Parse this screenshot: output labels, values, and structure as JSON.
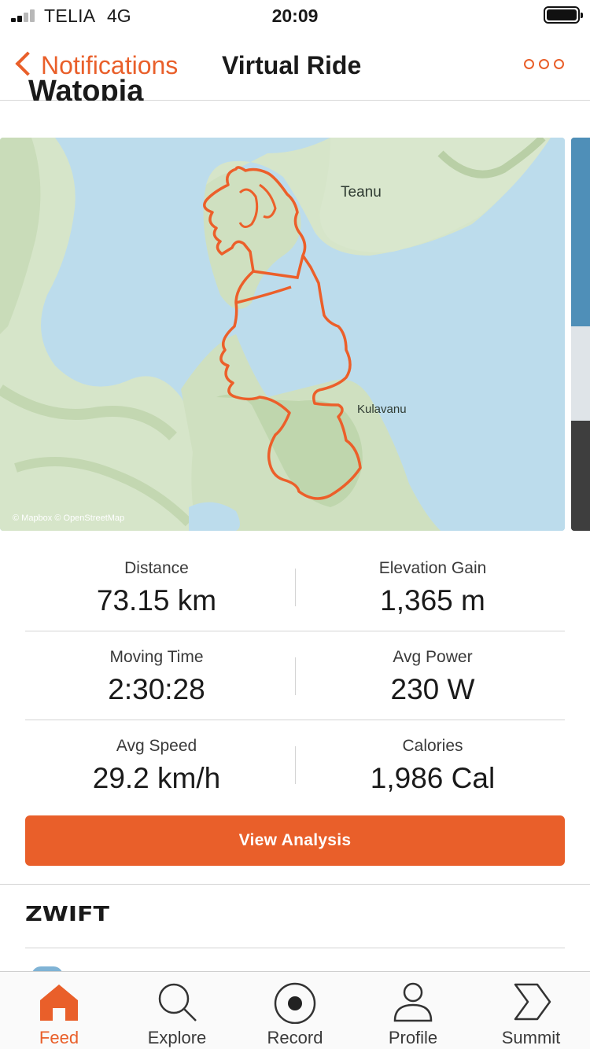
{
  "status_bar": {
    "carrier": "TELIA",
    "network": "4G",
    "time": "20:09"
  },
  "nav": {
    "back_label": "Notifications",
    "title": "Virtual Ride",
    "more_icon": "more-horizontal-icon"
  },
  "activity": {
    "partial_title": "Watopia"
  },
  "map": {
    "labels": {
      "teanu": "Teanu",
      "kulavanu": "Kulavanu"
    },
    "attribution": "© Mapbox © OpenStreetMap",
    "route_color": "#ec5f2a",
    "water_color": "#bcdcec",
    "land_color": "#d8e6cc"
  },
  "stats": {
    "distance": {
      "label": "Distance",
      "value": "73.15 km"
    },
    "elevation": {
      "label": "Elevation Gain",
      "value": "1,365 m"
    },
    "moving_time": {
      "label": "Moving Time",
      "value": "2:30:28"
    },
    "avg_power": {
      "label": "Avg Power",
      "value": "230 W"
    },
    "avg_speed": {
      "label": "Avg Speed",
      "value": "29.2 km/h"
    },
    "calories": {
      "label": "Calories",
      "value": "1,986 Cal"
    }
  },
  "actions": {
    "view_analysis": "View Analysis"
  },
  "partner": {
    "name": "ZWIFT"
  },
  "tabs": [
    {
      "label": "Feed",
      "icon": "home-icon",
      "active": true
    },
    {
      "label": "Explore",
      "icon": "search-icon",
      "active": false
    },
    {
      "label": "Record",
      "icon": "record-icon",
      "active": false
    },
    {
      "label": "Profile",
      "icon": "user-icon",
      "active": false
    },
    {
      "label": "Summit",
      "icon": "summit-icon",
      "active": false
    }
  ],
  "colors": {
    "accent": "#e95f2a",
    "text": "#1a1a1a",
    "divider": "#d4d4d4"
  }
}
